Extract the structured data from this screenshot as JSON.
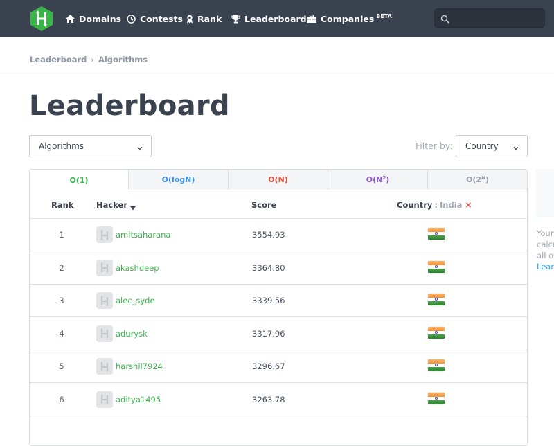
{
  "nav": {
    "logo": "hackerrank-logo",
    "items": [
      {
        "label": "Domains",
        "icon": "home-icon"
      },
      {
        "label": "Contests",
        "icon": "clock-icon"
      },
      {
        "label": "Rank",
        "icon": "medal-icon"
      },
      {
        "label": "Leaderboard",
        "icon": "trophy-icon"
      },
      {
        "label": "Companies",
        "icon": "briefcase-icon",
        "badge": "BETA"
      }
    ],
    "search": {
      "value": "",
      "placeholder": ""
    }
  },
  "breadcrumb": {
    "items": [
      "Leaderboard",
      "Algorithms"
    ],
    "separator": "›"
  },
  "page": {
    "title": "Leaderboard",
    "track_select": {
      "value": "Algorithms"
    },
    "filter_label": "Filter by:",
    "filter_select": {
      "value": "Country"
    }
  },
  "tabs": [
    {
      "label": "O(1)",
      "sup": "",
      "color": "#39b54a",
      "active": true
    },
    {
      "label": "O(logN)",
      "sup": "",
      "color": "#3b91e8",
      "active": false
    },
    {
      "label": "O(N)",
      "sup": "",
      "color": "#e94e3b",
      "active": false
    },
    {
      "label_pre": "O(N",
      "sup": "2",
      "label_post": ")",
      "color": "#8a5cd1",
      "active": false
    },
    {
      "label_pre": "O(2",
      "sup": "N",
      "label_post": ")",
      "color": "#9aa1ac",
      "active": false
    }
  ],
  "table": {
    "columns": {
      "rank": "Rank",
      "hacker": "Hacker",
      "score": "Score",
      "country": "Country",
      "country_filter_sep": ":",
      "country_filter_value": "India",
      "country_filter_clear": "×"
    },
    "rows": [
      {
        "rank": "1",
        "hacker": "amitsaharana",
        "score": "3554.93",
        "country": "India"
      },
      {
        "rank": "2",
        "hacker": "akashdeep",
        "score": "3364.80",
        "country": "India"
      },
      {
        "rank": "3",
        "hacker": "alec_syde",
        "score": "3339.56",
        "country": "India"
      },
      {
        "rank": "4",
        "hacker": "adurysk",
        "score": "3317.96",
        "country": "India"
      },
      {
        "rank": "5",
        "hacker": "harshil7924",
        "score": "3296.67",
        "country": "India"
      },
      {
        "rank": "6",
        "hacker": "aditya1495",
        "score": "3263.78",
        "country": "India"
      }
    ]
  },
  "side_panel": {
    "lines": [
      "Your",
      "calcu",
      "all of"
    ],
    "link": "Learn"
  },
  "colors": {
    "nav_bg": "#39424e",
    "brand_green": "#39b54a",
    "link_blue": "#1ba2f0",
    "clear_red": "#e94e3b"
  }
}
